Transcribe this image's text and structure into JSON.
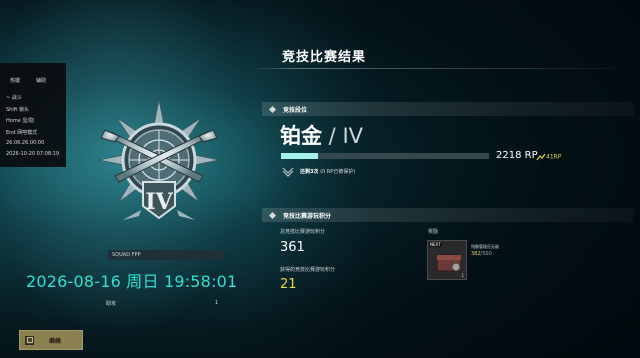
{
  "page_title": "竞技比赛结果",
  "overlay": {
    "tab_left": "热键",
    "tab_right": "辅助",
    "rows": [
      "~ 战斗",
      "Shift 锁头",
      "Home 显/隐",
      "End 网吧模式",
      "26.06.26.00.00",
      "2026-10-20 07:08:19"
    ]
  },
  "squad_label": "SQUAD FPP",
  "datetime": "2026-08-16 周日 19:58:01",
  "assist": {
    "label": "助攻",
    "value": "1"
  },
  "continue": {
    "key": "",
    "label": "继续"
  },
  "rank_section": {
    "header": "竞技段位",
    "tier": "铂金",
    "tier_sep": " / ",
    "division": "IV",
    "rp_value": "2218 RP",
    "rp_progress_fraction": 0.18,
    "rp_gain": "41RP",
    "protect_count": "还剩3次",
    "protect_text": "(0 RP已被保护)"
  },
  "score_section": {
    "header": "竞技比赛游玩积分",
    "total_label": "总竞技比赛游玩积分",
    "total_value": "361",
    "earned_label": "获得的竞技比赛游玩积分",
    "earned_value": "21"
  },
  "reward": {
    "label": "奖励",
    "next_badge": "NEXT",
    "count": "1",
    "name": "残骸管理员无敌",
    "progress_current": "382",
    "progress_total": "/500"
  },
  "colors": {
    "accent_teal": "#2fe0d0",
    "gold": "#e9d34a",
    "rp_fill": "#a4f2ea",
    "button": "#8a8050"
  }
}
